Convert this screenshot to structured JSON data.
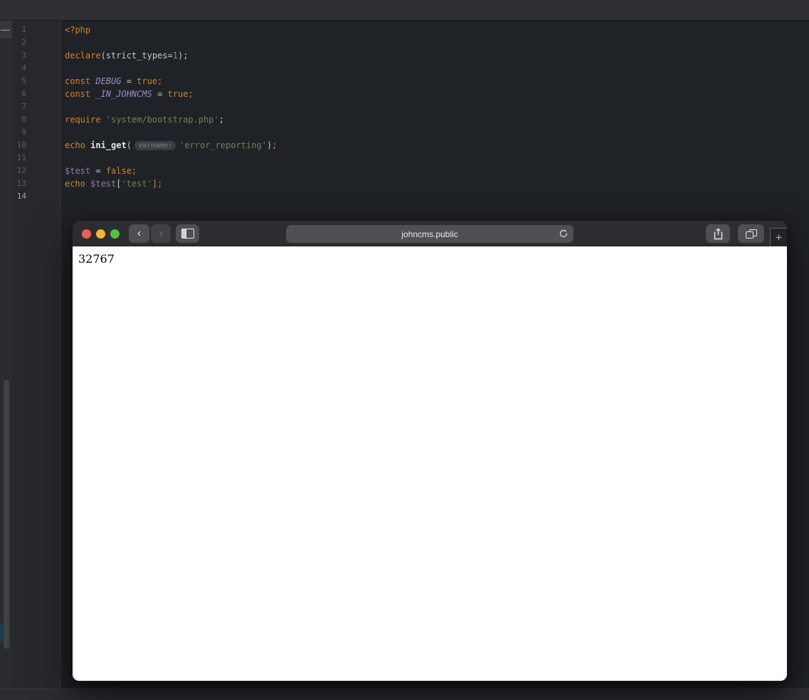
{
  "ide": {
    "rail": {
      "dash_icon": "—",
      "icons": [
        "collapsed-toolwindow-dash-icon",
        "editor-scrollbar-thumb",
        "teal-toolwindow-tag"
      ]
    },
    "gutter": {
      "current_line": 14,
      "line_count": 14
    },
    "code_lines": [
      {
        "n": 1,
        "tokens": [
          {
            "t": "<?php",
            "s": "k"
          }
        ]
      },
      {
        "n": 2,
        "tokens": []
      },
      {
        "n": 3,
        "tokens": [
          {
            "t": "declare",
            "s": "k"
          },
          {
            "t": "(strict_types=",
            "s": "p"
          },
          {
            "t": "1",
            "s": "n"
          },
          {
            "t": ");",
            "s": "p"
          }
        ]
      },
      {
        "n": 4,
        "tokens": []
      },
      {
        "n": 5,
        "tokens": [
          {
            "t": "const ",
            "s": "k"
          },
          {
            "t": "DEBUG",
            "s": "c"
          },
          {
            "t": " = ",
            "s": "p"
          },
          {
            "t": "true;",
            "s": "k"
          }
        ]
      },
      {
        "n": 6,
        "tokens": [
          {
            "t": "const ",
            "s": "k"
          },
          {
            "t": "_IN_JOHNCMS",
            "s": "c"
          },
          {
            "t": " = ",
            "s": "p"
          },
          {
            "t": "true;",
            "s": "k"
          }
        ]
      },
      {
        "n": 7,
        "tokens": []
      },
      {
        "n": 8,
        "tokens": [
          {
            "t": "require ",
            "s": "k"
          },
          {
            "t": "'system/bootstrap.php'",
            "s": "s"
          },
          {
            "t": ";",
            "s": "p"
          }
        ]
      },
      {
        "n": 9,
        "tokens": []
      },
      {
        "n": 10,
        "tokens": [
          {
            "t": "echo ",
            "s": "k"
          },
          {
            "t": "ini_get",
            "s": "f"
          },
          {
            "t": "(",
            "s": "p"
          },
          {
            "t": "varname:",
            "s": "hint"
          },
          {
            "t": "'error_reporting'",
            "s": "s"
          },
          {
            "t": ")",
            "s": "p"
          },
          {
            "t": ";",
            "s": "k"
          }
        ]
      },
      {
        "n": 11,
        "tokens": []
      },
      {
        "n": 12,
        "tokens": [
          {
            "t": "$test",
            "s": "v"
          },
          {
            "t": " = ",
            "s": "p"
          },
          {
            "t": "false;",
            "s": "k"
          }
        ]
      },
      {
        "n": 13,
        "tokens": [
          {
            "t": "echo ",
            "s": "k"
          },
          {
            "t": "$test",
            "s": "v"
          },
          {
            "t": "[",
            "s": "p"
          },
          {
            "t": "'test'",
            "s": "s"
          },
          {
            "t": "];",
            "s": "k"
          }
        ]
      },
      {
        "n": 14,
        "tokens": []
      }
    ],
    "syntax_colors": {
      "keyword": "#d0832f",
      "constant": "#9e8cc9",
      "variable": "#9876aa",
      "string": "#6a8759",
      "number": "#6897bb",
      "plain": "#c5c8ca",
      "function": "#e3e5e6",
      "inlay_hint_bg": "#3b3e41"
    }
  },
  "browser": {
    "toolbar": {
      "back_icon": "‹",
      "forward_icon": "›",
      "address_value": "johncms.public",
      "icons": [
        "back-icon",
        "forward-icon",
        "sidebar-icon",
        "reload-icon",
        "share-icon",
        "tabs-overview-icon"
      ]
    },
    "traffic_lights": {
      "close": "#ec5f55",
      "minimize": "#f5b42e",
      "zoom": "#57c23d"
    },
    "page": {
      "content": "32767"
    },
    "new_tab_button": "+"
  },
  "colors": {
    "ide_titlebar": "#2e3034",
    "editor_bg": "#1f2226",
    "gutter_bg": "#26282c",
    "safari_toolbar": "#2b2d30",
    "toolbar_button": "#4d4f52",
    "page_bg": "#ffffff"
  }
}
